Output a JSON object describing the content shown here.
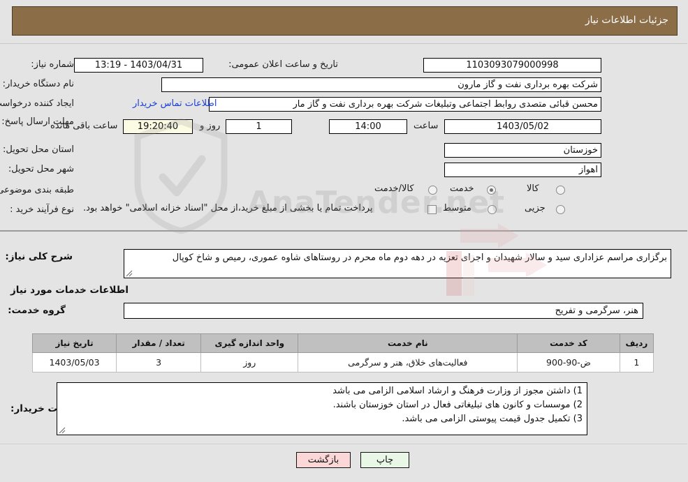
{
  "header": {
    "title": "جزئیات اطلاعات نیاز",
    "bg_color": "#8b6d47"
  },
  "watermark": {
    "text": "AnaTender.net"
  },
  "form": {
    "need_number": {
      "label": "شماره نیاز:",
      "value": "1103093079000998"
    },
    "announce_datetime": {
      "label": "تاریخ و ساعت اعلان عمومی:",
      "value": "1403/04/31 - 13:19"
    },
    "buyer_org": {
      "label": "نام دستگاه خریدار:",
      "value": "شرکت بهره برداری نفت و گاز مارون"
    },
    "requester": {
      "label": "ایجاد کننده درخواست:",
      "value": "محسن قبائی متصدی روابط اجتماعی وتبلیغات شرکت بهره برداری نفت و گاز مار"
    },
    "contact_link": {
      "label": "اطلاعات تماس خریدار"
    },
    "deadline": {
      "label": "مهلت ارسال پاسخ: تا تاریخ:",
      "date": "1403/05/02",
      "hour_label": "ساعت",
      "hour": "14:00",
      "days": "1",
      "days_label": "روز و",
      "countdown": "19:20:40",
      "remaining_label": "ساعت باقی مانده"
    },
    "province": {
      "label": "استان محل تحویل:",
      "value": "خوزستان"
    },
    "city": {
      "label": "شهر محل تحویل:",
      "value": "اهواز"
    },
    "category": {
      "label": "طبقه بندی موضوعی:",
      "options": [
        "کالا",
        "خدمت",
        "کالا/خدمت"
      ],
      "selected": "خدمت"
    },
    "purchase_type": {
      "label": "نوع فرآیند خرید :",
      "options": [
        "جزیی",
        "متوسط"
      ],
      "selected": "",
      "checkbox_note": "پرداخت تمام یا بخشی از مبلغ خرید،از محل \"اسناد خزانه اسلامی\" خواهد بود.",
      "checkbox_checked": false
    }
  },
  "description": {
    "label": "شرح کلی نیاز:",
    "value": "برگزاری مراسم  عزاداری سید و سالار شهیدان و اجرای تعزیه در دهه دوم ماه محرم در روستاهای شاوه عموری، رمیص و شاخ کوپال"
  },
  "services_section": {
    "heading": "اطلاعات خدمات مورد نیاز",
    "group": {
      "label": "گروه خدمت:",
      "value": "هنر، سرگرمی و تفریح"
    },
    "table": {
      "columns": [
        "ردیف",
        "کد خدمت",
        "نام خدمت",
        "واحد اندازه گیری",
        "تعداد / مقدار",
        "تاریخ نیاز"
      ],
      "rows": [
        {
          "index": "1",
          "code": "ض-90-900",
          "name": "فعالیت‌های خلاق، هنر و سرگرمی",
          "unit": "روز",
          "quantity": "3",
          "date": "1403/05/03"
        }
      ]
    }
  },
  "buyer_notes": {
    "label": "توضیحات خریدار:",
    "lines": [
      "1) داشتن مجوز از وزارت فرهنگ و ارشاد اسلامی الزامی می باشد",
      "2) موسسات و کانون های تبلیغاتی فعال در استان خوزستان باشند.",
      "3) تکمیل جدول قیمت پیوستی الزامی می باشد."
    ]
  },
  "footer": {
    "print_label": "چاپ",
    "back_label": "بازگشت"
  }
}
